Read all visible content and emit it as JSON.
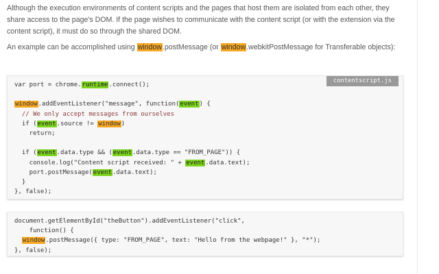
{
  "paragraph1": {
    "text": "Although the execution environments of content scripts and the pages that host them are isolated from each other, they share access to the page's DOM. If the page wishes to communicate with the content script (or with the extension via the content script), it must do so through the shared DOM."
  },
  "paragraph2": {
    "part1": "An example can be accomplished using ",
    "hl1": "window",
    "part2": ".postMessage (or ",
    "hl2": "window",
    "part3": ".webkitPostMessage for Transferable objects):"
  },
  "code_block_1": {
    "filename": "contentscript.js",
    "line01": {
      "a": "var port = chrome.",
      "hl": "runtime",
      "b": ".connect();"
    },
    "line02": "",
    "line03": {
      "hl1": "window",
      "a": ".addEventListener(\"message\", function(",
      "hl2": "event",
      "b": ") {"
    },
    "line04": "  // We only accept messages from ourselves",
    "line05": {
      "a": "  if (",
      "hl1": "event",
      "b": ".source != ",
      "hl2": "window",
      "c": ")"
    },
    "line06": "    return;",
    "line07": "",
    "line08": {
      "a": "  if (",
      "hl1": "event",
      "b": ".data.type && (",
      "hl2": "event",
      "c": ".data.type == \"FROM_PAGE\")) {"
    },
    "line09": {
      "a": "    console.log(\"Content script received: \" + ",
      "hl": "event",
      "b": ".data.text);"
    },
    "line10": {
      "a": "    port.postMessage(",
      "hl": "event",
      "b": ".data.text);"
    },
    "line11": "  }",
    "line12": "}, false);"
  },
  "code_block_2": {
    "line01": "document.getElementById(\"theButton\").addEventListener(\"click\",",
    "line02": "    function() {",
    "line03": {
      "a": "  ",
      "hl": "window",
      "b": ".postMessage({ type: \"FROM_PAGE\", text: \"Hello from the webpage!\" }, \"*\");"
    },
    "line04": "}, false);"
  }
}
